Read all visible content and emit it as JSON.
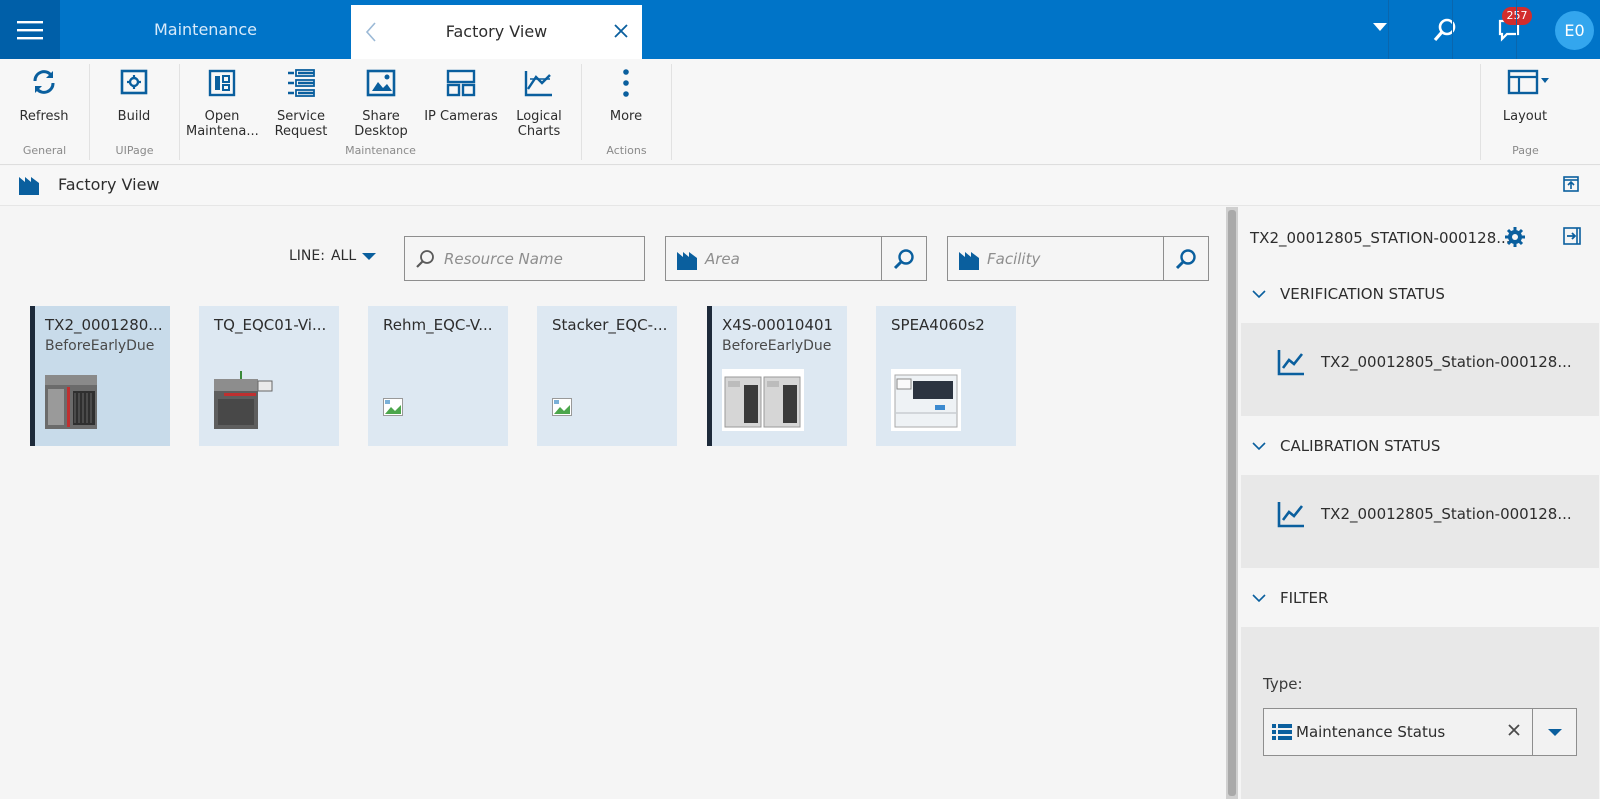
{
  "topbar": {
    "tabs": [
      {
        "label": "Maintenance"
      },
      {
        "label": "Factory View"
      }
    ],
    "notification_count": "257",
    "user_initials": "E0"
  },
  "ribbon": {
    "buttons": {
      "refresh": "Refresh",
      "build": "Build",
      "open_maintenance": "Open\nMaintena...",
      "service_request": "Service\nRequest",
      "share_desktop": "Share\nDesktop",
      "ip_cameras": "IP Cameras",
      "logical_charts": "Logical\nCharts",
      "more": "More",
      "layout": "Layout"
    },
    "groups": {
      "general": "General",
      "uipage": "UIPage",
      "maintenance": "Maintenance",
      "actions": "Actions",
      "page": "Page"
    }
  },
  "page": {
    "title": "Factory View"
  },
  "filters": {
    "line_label": "LINE:",
    "line_value": "ALL",
    "resource_placeholder": "Resource Name",
    "area_placeholder": "Area",
    "facility_placeholder": "Facility"
  },
  "resources": [
    {
      "name": "TX2_0001280...",
      "status": "BeforeEarlyDue",
      "image": "tx2-machine",
      "selected": true,
      "flagged": true
    },
    {
      "name": "TQ_EQC01-Vi...",
      "status": "",
      "image": "tq-machine",
      "selected": false,
      "flagged": false
    },
    {
      "name": "Rehm_EQC-V...",
      "status": "",
      "image": "broken-image",
      "selected": false,
      "flagged": false
    },
    {
      "name": "Stacker_EQC-...",
      "status": "",
      "image": "broken-image",
      "selected": false,
      "flagged": false
    },
    {
      "name": "X4S-00010401",
      "status": "BeforeEarlyDue",
      "image": "x4s-machine",
      "selected": false,
      "flagged": true
    },
    {
      "name": "SPEA4060s2",
      "status": "",
      "image": "spea-machine",
      "selected": false,
      "flagged": false
    }
  ],
  "right_panel": {
    "title": "TX2_00012805_STATION-000128...",
    "sections": [
      {
        "header": "VERIFICATION STATUS",
        "item": "TX2_00012805_Station-000128..."
      },
      {
        "header": "CALIBRATION STATUS",
        "item": "TX2_00012805_Station-000128..."
      },
      {
        "header": "FILTER"
      }
    ],
    "filter": {
      "type_label": "Type:",
      "type_value": "Maintenance Status"
    }
  },
  "colors": {
    "topbar": "#0074c8",
    "accent": "#005a9e",
    "card": "#dde8f2",
    "card_selected": "#c8dbea"
  }
}
